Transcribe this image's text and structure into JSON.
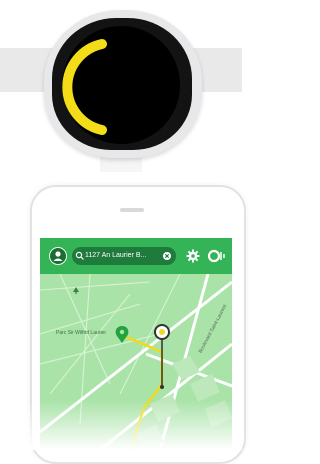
{
  "colors": {
    "appbar": "#35b357",
    "map": "#a9e3a8",
    "route": "#f0d91e",
    "watch_arc": "#f3dd18"
  },
  "watch": {
    "icons": {
      "arc": "progress-arc"
    }
  },
  "app": {
    "search": {
      "text": "1127 An Laurier B..."
    },
    "park_label": "Parc Sir Wilfrid Laurier",
    "street_label": "Boulevard Saint-Laurent",
    "icons": {
      "account": "account-icon",
      "search": "search-icon",
      "clear": "clear-icon",
      "settings": "gear-icon",
      "record": "record-icon",
      "park": "tree-icon",
      "location": "location-pin-icon",
      "destination": "destination-icon"
    }
  }
}
